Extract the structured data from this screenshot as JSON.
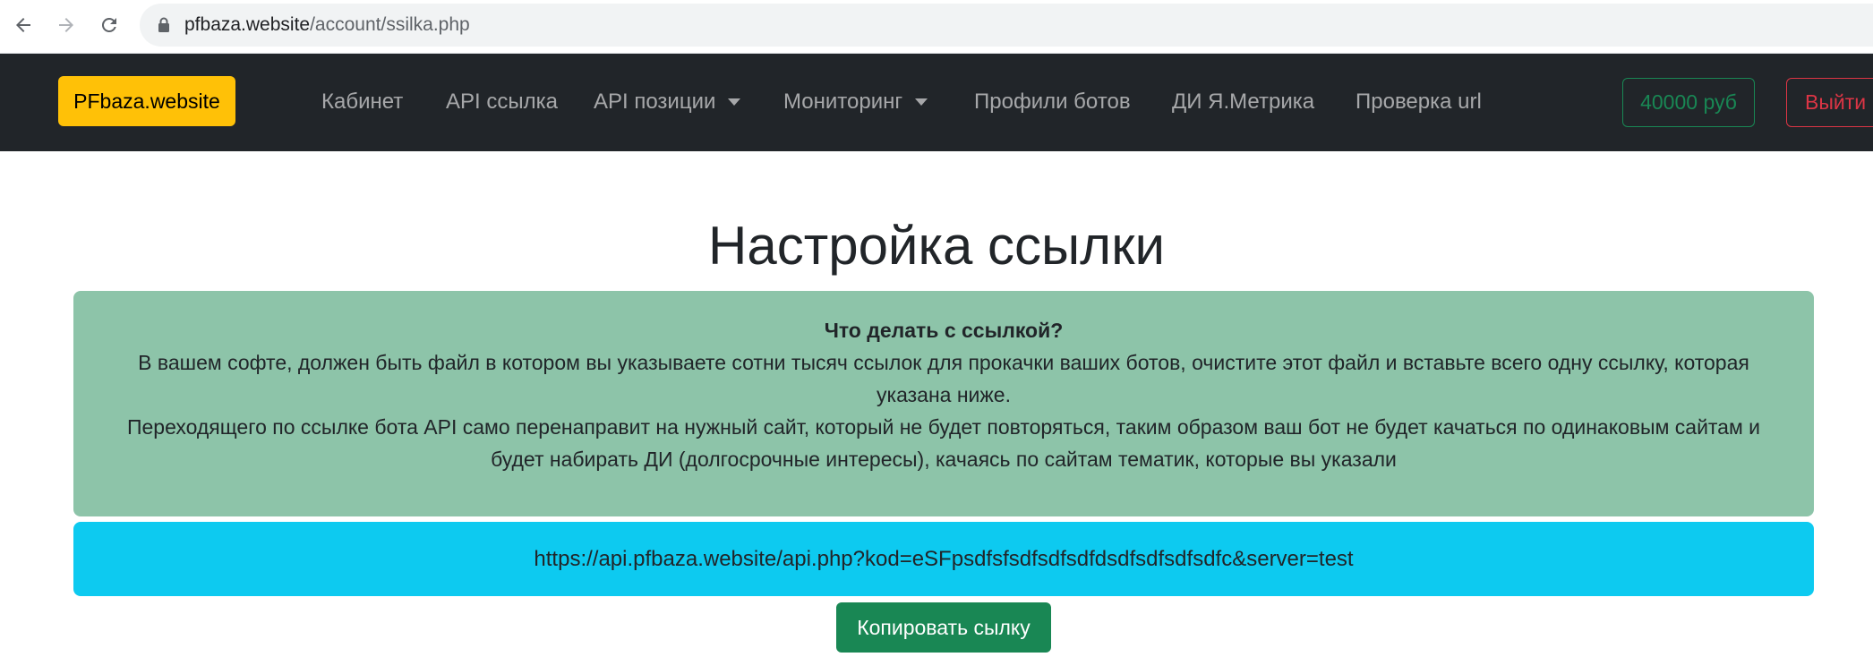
{
  "browser": {
    "url_host": "pfbaza.website",
    "url_path": "/account/ssilka.php"
  },
  "navbar": {
    "brand": "PFbaza.website",
    "items": [
      {
        "label": "Кабинет"
      },
      {
        "label": "API ссылка"
      },
      {
        "label": "API позиции"
      },
      {
        "label": "Мониторинг"
      },
      {
        "label": "Профили ботов"
      },
      {
        "label": "ДИ Я.Метрика"
      },
      {
        "label": "Проверка url"
      }
    ],
    "balance": "40000 руб",
    "logout": "Выйти"
  },
  "main": {
    "title": "Настройка ссылки",
    "info": {
      "question": "Что делать с ссылкой?",
      "paragraph1": "В вашем софте, должен быть файл в котором вы указываете сотни тысяч ссылок для прокачки ваших ботов, очистите этот файл и вставьте всего одну ссылку, которая указана ниже.",
      "paragraph2": "Переходящего по ссылке бота API само перенаправит на нужный сайт, который не будет повторяться, таким образом ваш бот не будет качаться по одинаковым сайтам и будет набирать ДИ (долгосрочные интересы), качаясь по сайтам тематик, которые вы указали"
    },
    "link": "https://api.pfbaza.website/api.php?kod=eSFpsdfsfsdfsdfsdfdsdfsdfsdfsdfc&server=test",
    "copy_button": "Копировать сылку"
  },
  "colors": {
    "navbar_bg": "#212529",
    "brand_bg": "#ffc107",
    "info_bg": "#8dc4a9",
    "link_bg": "#0dcaf0",
    "success": "#198754",
    "danger": "#dc3545"
  }
}
